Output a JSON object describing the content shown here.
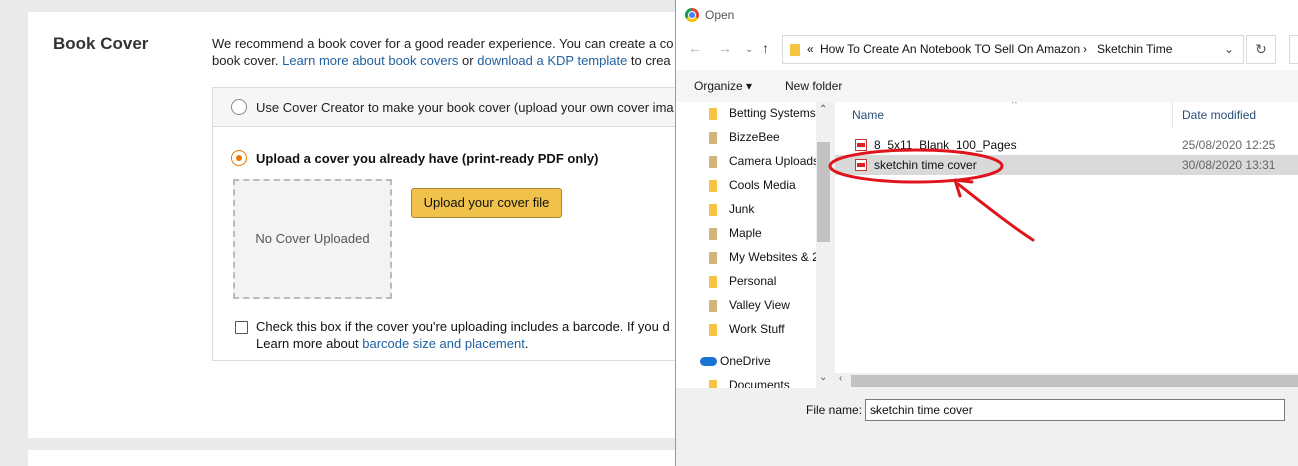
{
  "kdp": {
    "section_title": "Book Cover",
    "desc_text_1": "We recommend a book cover for a good reader experience. You can create a co",
    "desc_text_2": "book cover. ",
    "link_learn_covers": "Learn more about book covers",
    "or_text": " or ",
    "link_kdp_template": "download a KDP template",
    "desc_tail": " to crea",
    "option_cover_creator": "Use Cover Creator to make your book cover (upload your own cover ima",
    "option_upload": "Upload a cover you already have (print-ready PDF only)",
    "no_cover": "No Cover Uploaded",
    "upload_button": "Upload your cover file",
    "barcode_text_1": "Check this box if the cover you're uploading includes a barcode. If you d",
    "barcode_text_2": "Learn more about ",
    "link_barcode": "barcode size and placement",
    "barcode_period": "."
  },
  "dialog": {
    "title": "Open",
    "breadcrumb_prefix": "«",
    "breadcrumb_1": "How To Create An Notebook TO Sell On Amazon",
    "breadcrumb_sep": "›",
    "breadcrumb_2": "Sketchin Time",
    "organize": "Organize ▾",
    "new_folder": "New folder",
    "nav_items": [
      "Betting Systems",
      "BizzeBee",
      "Camera Uploads",
      "Cools Media",
      "Junk",
      "Maple",
      "My Websites & 2",
      "Personal",
      "Valley View",
      "Work Stuff"
    ],
    "onedrive": "OneDrive",
    "documents": "Documents",
    "col_name": "Name",
    "col_date": "Date modified",
    "files": [
      {
        "name": "8_5x11_Blank_100_Pages",
        "date": "25/08/2020 12:25"
      },
      {
        "name": "sketchin time cover",
        "date": "30/08/2020 13:31"
      }
    ],
    "file_name_label": "File name:",
    "file_name_value": "sketchin time cover"
  },
  "colors": {
    "upload_button": "#f0c14b",
    "link": "#2162a1",
    "radio_selected": "#e77600",
    "annotation": "#e0141c"
  },
  "icons": [
    "chrome-icon",
    "back-arrow-icon",
    "forward-arrow-icon",
    "up-arrow-icon",
    "folder-icon",
    "refresh-icon",
    "pdf-icon",
    "onedrive-icon",
    "dropdown-icon",
    "sort-caret-icon"
  ]
}
